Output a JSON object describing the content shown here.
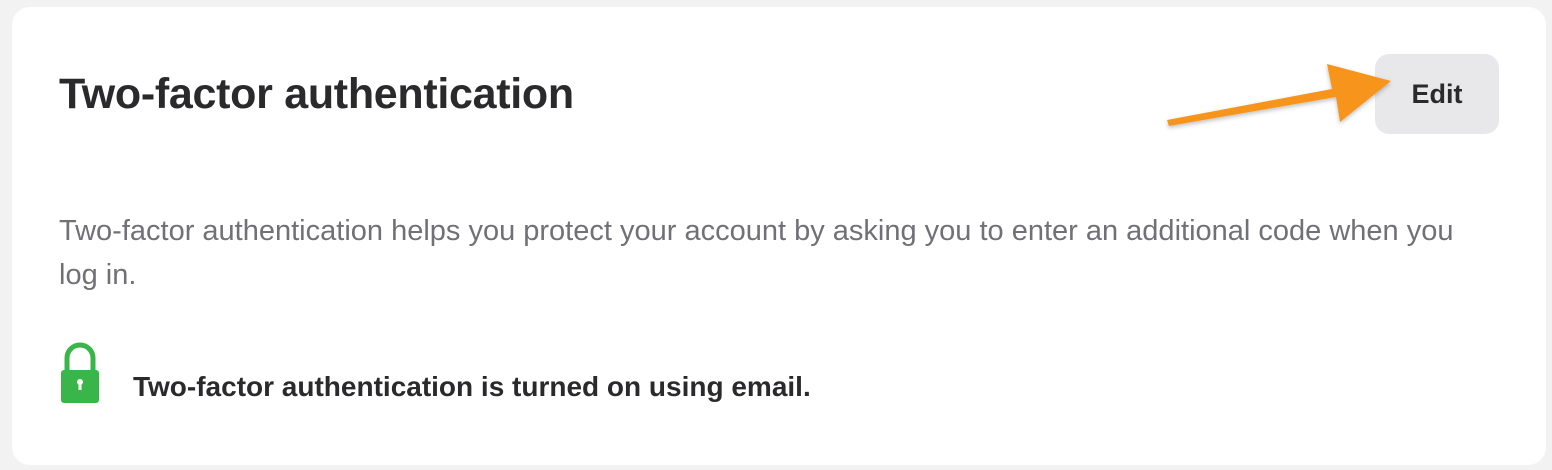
{
  "section": {
    "title": "Two-factor authentication",
    "edit_label": "Edit",
    "description": "Two-factor authentication helps you protect your account by asking you to enter an additional code when you log in.",
    "status_text": "Two-factor authentication is turned on using email.",
    "status_icon": "lock-icon"
  },
  "colors": {
    "status_icon": "#39b54a",
    "annotation_arrow": "#f7941d",
    "edit_button_bg": "#e8e8ea"
  }
}
